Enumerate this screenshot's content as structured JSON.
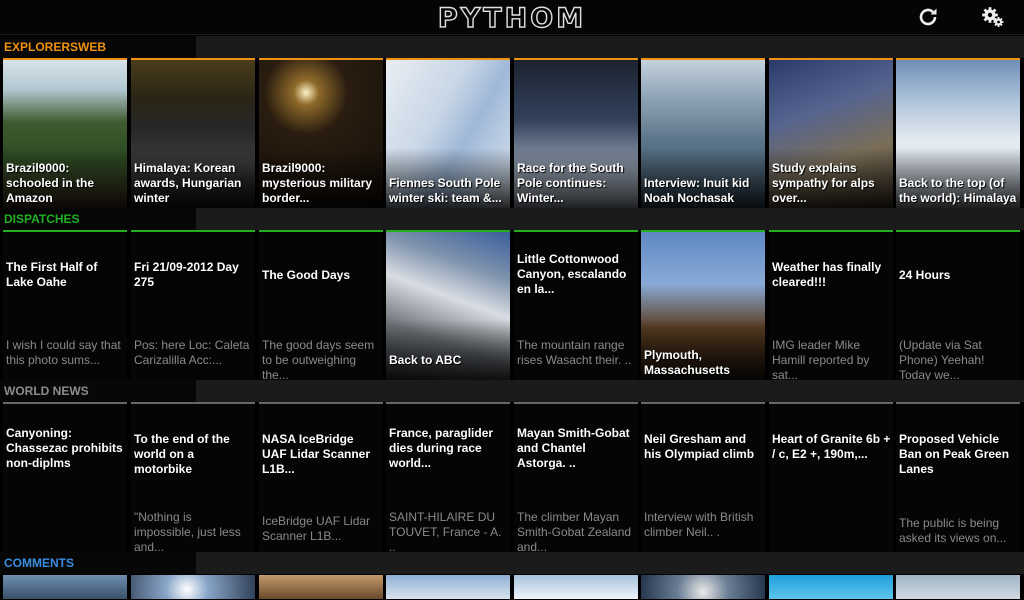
{
  "app": {
    "logo": "PYTHOM"
  },
  "toolbar": {
    "refresh_icon": "refresh-icon",
    "settings_icon": "gear-icon"
  },
  "colors": {
    "explorersweb": "#f0920f",
    "dispatches": "#22b022",
    "world_news": "#8c8c8c",
    "comments": "#3a8de0"
  },
  "sections": {
    "explorersweb": {
      "label": "EXPLORERSWEB",
      "items": [
        {
          "title": "Brazil9000: schooled in the Amazon"
        },
        {
          "title": "Himalaya: Korean awards, Hungarian winter"
        },
        {
          "title": "Brazil9000: mysterious military border..."
        },
        {
          "title": "Fiennes South Pole winter ski: team &..."
        },
        {
          "title": "Race for the South Pole continues: Winter..."
        },
        {
          "title": "Interview: Inuit kid Noah Nochasak"
        },
        {
          "title": "Study explains sympathy for alps over..."
        },
        {
          "title": "Back to the top (of the world): Himalaya"
        }
      ]
    },
    "dispatches": {
      "label": "DISPATCHES",
      "items": [
        {
          "title": "The First Half of Lake Oahe",
          "snippet": "I wish I could say that this photo sums..."
        },
        {
          "title": "Fri 21/09-2012 Day 275",
          "snippet": "Pos: here Loc: Caleta Carizalilla Acc:..."
        },
        {
          "title": "The Good Days",
          "snippet": "The good days seem to be outweighing the..."
        },
        {
          "title": "Back to ABC"
        },
        {
          "title": "Little Cottonwood Canyon, escalando en la...",
          "snippet": "The mountain range rises Wasacht their. .."
        },
        {
          "title": "Plymouth, Massachusetts"
        },
        {
          "title": "Weather has finally cleared!!!",
          "snippet": "IMG leader Mike Hamill reported by sat..."
        },
        {
          "title": "24 Hours",
          "snippet": "(Update via Sat Phone) Yeehah! Today we..."
        }
      ]
    },
    "world_news": {
      "label": "WORLD NEWS",
      "items": [
        {
          "title": "Canyoning: Chassezac prohibits non-diplms",
          "snippet": ""
        },
        {
          "title": "To the end of the world on a motorbike",
          "snippet": "\"Nothing is impossible, just less and..."
        },
        {
          "title": "NASA IceBridge UAF Lidar Scanner L1B...",
          "snippet": "IceBridge UAF Lidar Scanner L1B..."
        },
        {
          "title": "France, paraglider dies during race world...",
          "snippet": "SAINT-HILAIRE DU TOUVET, France - A. .."
        },
        {
          "title": "Mayan Smith-Gobat and Chantel Astorga. ..",
          "snippet": "The climber Mayan Smith-Gobat Zealand and..."
        },
        {
          "title": "Neil Gresham and his Olympiad climb",
          "snippet": "Interview with British climber Neil.. ."
        },
        {
          "title": "Heart of Granite 6b + / c, E2 +, 190m,...",
          "snippet": ""
        },
        {
          "title": "Proposed Vehicle Ban on Peak Green Lanes",
          "snippet": "The public is being asked its views on..."
        }
      ]
    },
    "comments": {
      "label": "COMMENTS"
    }
  }
}
